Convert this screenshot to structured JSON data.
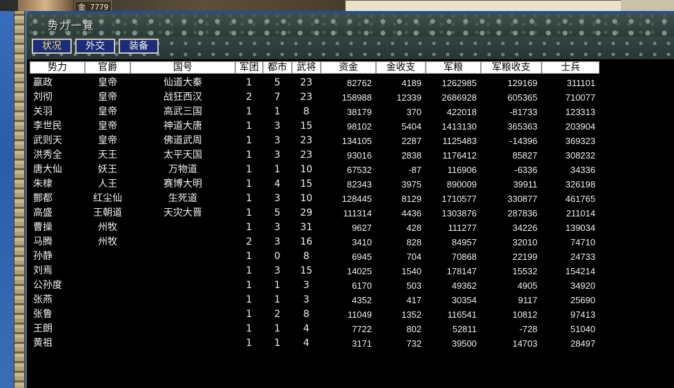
{
  "window": {
    "title": "势力一覽"
  },
  "top_bar": {
    "gold_text": "金 7779"
  },
  "tabs": [
    {
      "label": "状况",
      "active": true
    },
    {
      "label": "外交",
      "active": false
    },
    {
      "label": "装备",
      "active": false
    }
  ],
  "table": {
    "columns": [
      "势力",
      "官爵",
      "国号",
      "军团",
      "都市",
      "武将",
      "资金",
      "金收支",
      "军粮",
      "军粮收支",
      "士兵"
    ],
    "rows": [
      [
        "嬴政",
        "皇帝",
        "仙道大秦",
        "1",
        "5",
        "23",
        "82762",
        "4189",
        "1262985",
        "129169",
        "311101"
      ],
      [
        "刘彻",
        "皇帝",
        "战狂西汉",
        "2",
        "7",
        "23",
        "158988",
        "12339",
        "2686928",
        "605365",
        "710077"
      ],
      [
        "关羽",
        "皇帝",
        "高武三国",
        "1",
        "1",
        "8",
        "38179",
        "370",
        "422018",
        "-81733",
        "123313"
      ],
      [
        "李世民",
        "皇帝",
        "神道大唐",
        "1",
        "3",
        "15",
        "98102",
        "5404",
        "1413130",
        "365363",
        "203904"
      ],
      [
        "武则天",
        "皇帝",
        "佛道武周",
        "1",
        "3",
        "23",
        "134105",
        "2287",
        "1125483",
        "-14396",
        "369323"
      ],
      [
        "洪秀全",
        "天王",
        "太平天国",
        "1",
        "3",
        "23",
        "93016",
        "2838",
        "1176412",
        "85827",
        "308232"
      ],
      [
        "唐大仙",
        "妖王",
        "万物道",
        "1",
        "1",
        "10",
        "67532",
        "-87",
        "116906",
        "-6336",
        "34336"
      ],
      [
        "朱棣",
        "人王",
        "赛博大明",
        "1",
        "4",
        "15",
        "82343",
        "3975",
        "890009",
        "39911",
        "326198"
      ],
      [
        "酆都",
        "红尘仙",
        "生死道",
        "1",
        "3",
        "10",
        "128445",
        "8129",
        "1710577",
        "330877",
        "461765"
      ],
      [
        "高盛",
        "王朝道",
        "天灾大晋",
        "1",
        "5",
        "29",
        "111314",
        "4436",
        "1303876",
        "287836",
        "211014"
      ],
      [
        "曹操",
        "州牧",
        "",
        "1",
        "3",
        "31",
        "9627",
        "428",
        "111277",
        "34226",
        "139034"
      ],
      [
        "马腾",
        "州牧",
        "",
        "2",
        "3",
        "16",
        "3410",
        "828",
        "84957",
        "32010",
        "74710"
      ],
      [
        "孙静",
        "",
        "",
        "1",
        "0",
        "8",
        "6945",
        "704",
        "70868",
        "22199",
        "24733"
      ],
      [
        "刘焉",
        "",
        "",
        "1",
        "3",
        "15",
        "14025",
        "1540",
        "178147",
        "15532",
        "154214"
      ],
      [
        "公孙度",
        "",
        "",
        "1",
        "1",
        "3",
        "6170",
        "503",
        "49362",
        "4905",
        "34920"
      ],
      [
        "张燕",
        "",
        "",
        "1",
        "1",
        "3",
        "4352",
        "417",
        "30354",
        "9117",
        "25690"
      ],
      [
        "张鲁",
        "",
        "",
        "1",
        "2",
        "8",
        "11049",
        "1352",
        "116541",
        "10812",
        "97413"
      ],
      [
        "王朗",
        "",
        "",
        "1",
        "1",
        "4",
        "7722",
        "802",
        "52811",
        "-728",
        "51040"
      ],
      [
        "黄祖",
        "",
        "",
        "1",
        "1",
        "4",
        "3171",
        "732",
        "39500",
        "14703",
        "28497"
      ]
    ]
  }
}
